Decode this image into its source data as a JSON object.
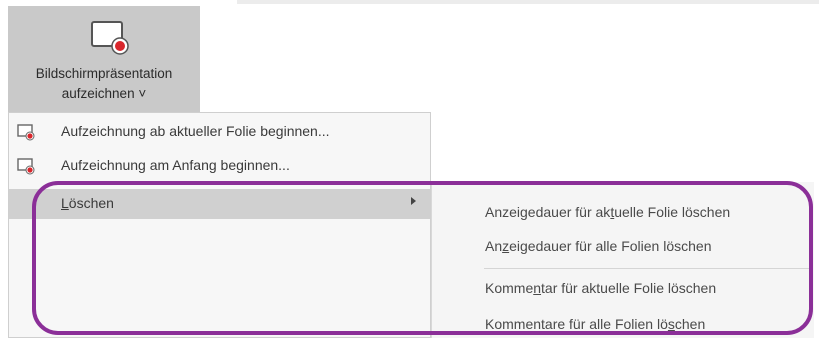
{
  "ribbon": {
    "button_label_line1": "Bildschirmpräsentation",
    "button_label_line2": "aufzeichnen ˅"
  },
  "menu": {
    "items": [
      {
        "label": "Aufzeichnung ab aktueller Folie beginnen...",
        "icon": "record-slide-icon"
      },
      {
        "label": "Aufzeichnung am Anfang beginnen...",
        "icon": "record-slide-icon"
      },
      {
        "label": "Löschen",
        "accesskey": "L",
        "label_rest": "öschen",
        "has_submenu": true
      }
    ]
  },
  "submenu": {
    "items": [
      {
        "before": "Anzeigedauer für ak",
        "key": "t",
        "after": "uelle Folie löschen"
      },
      {
        "before": "An",
        "key": "z",
        "after": "eigedauer für alle Folien löschen"
      },
      {
        "before": "Komme",
        "key": "n",
        "after": "tar für aktuelle Folie löschen"
      },
      {
        "before": "Kommentare für alle Folien lö",
        "key": "s",
        "after": "chen"
      }
    ]
  },
  "colors": {
    "highlight": "#8b2f98",
    "record_dot": "#d9262c",
    "button_bg": "#c9c9c9",
    "hover_bg": "#d0d0d0"
  }
}
